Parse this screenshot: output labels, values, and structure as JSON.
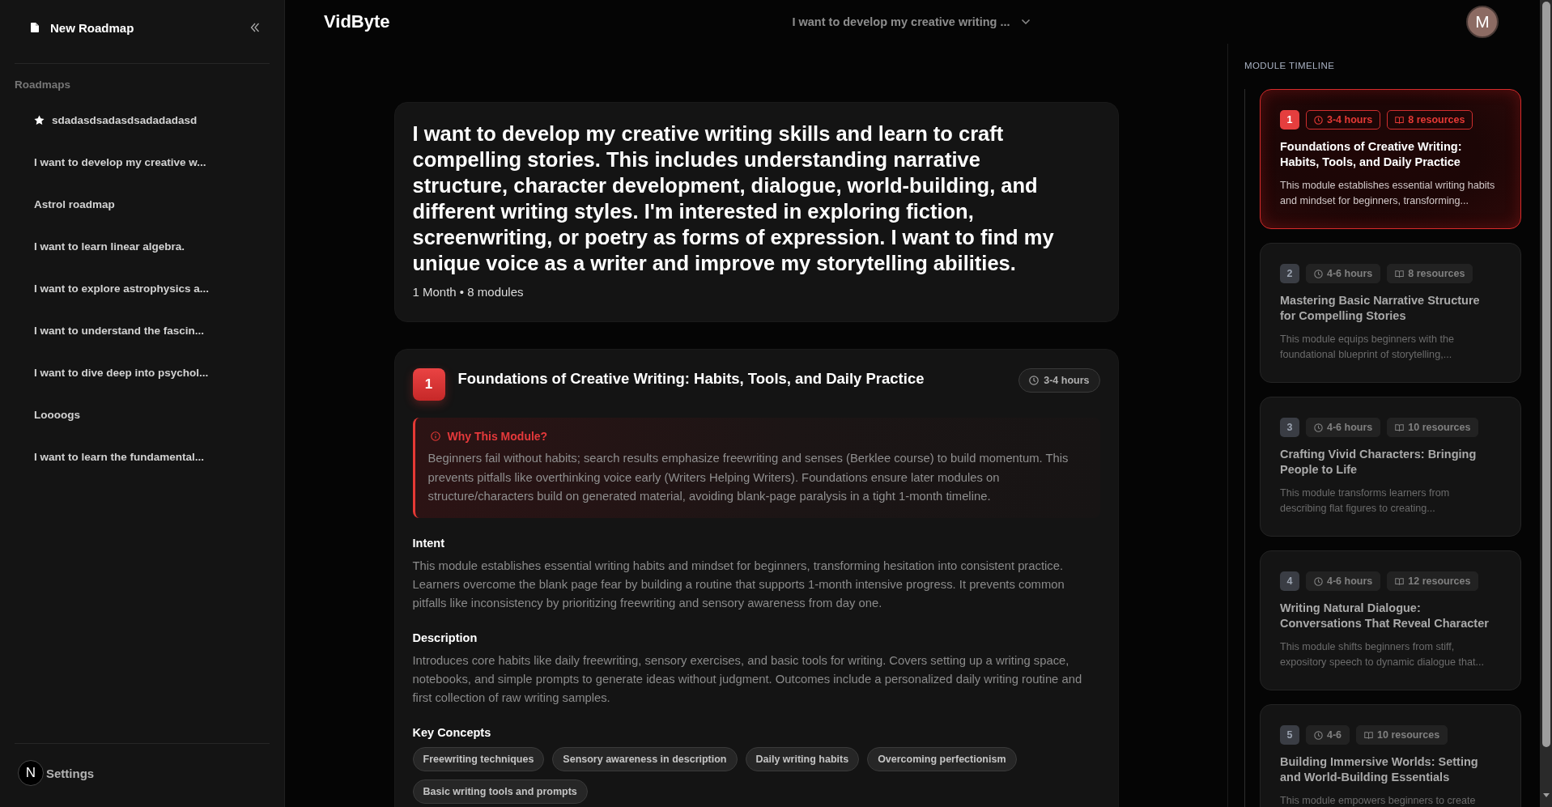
{
  "sidebar": {
    "new_button": "New Roadmap",
    "section_title": "Roadmaps",
    "items": [
      {
        "label": "sdadasdsadasdsadadadasd",
        "starred": true
      },
      {
        "label": "I want to develop my creative w...",
        "starred": false
      },
      {
        "label": "Astrol roadmap",
        "starred": false
      },
      {
        "label": "I want to learn linear algebra.",
        "starred": false
      },
      {
        "label": "I want to explore astrophysics a...",
        "starred": false
      },
      {
        "label": "I want to understand the fascin...",
        "starred": false
      },
      {
        "label": "I want to dive deep into psychol...",
        "starred": false
      },
      {
        "label": "Loooogs",
        "starred": false
      },
      {
        "label": "I want to learn the fundamental...",
        "starred": false
      }
    ],
    "footer": {
      "avatar_letter": "N",
      "label": "Settings"
    }
  },
  "header": {
    "logo": "VidByte",
    "roadmap_select": "I want to develop my creative writing ...",
    "avatar_letter": "M"
  },
  "roadmap": {
    "title": "I want to develop my creative writing skills and learn to craft compelling stories. This includes understanding narrative structure, character development, dialogue, world-building, and different writing styles. I'm interested in exploring fiction, screenwriting, or poetry as forms of expression. I want to find my unique voice as a writer and improve my storytelling abilities.",
    "meta": "1 Month • 8 modules"
  },
  "module": {
    "number": "1",
    "title": "Foundations of Creative Writing: Habits, Tools, and Daily Practice",
    "duration": "3-4 hours",
    "why": {
      "title": "Why This Module?",
      "text": "Beginners fail without habits; search results emphasize freewriting and senses (Berklee course) to build momentum. This prevents pitfalls like overthinking voice early (Writers Helping Writers). Foundations ensure later modules on structure/characters build on generated material, avoiding blank-page paralysis in a tight 1-month timeline."
    },
    "sections": [
      {
        "heading": "Intent",
        "text": "This module establishes essential writing habits and mindset for beginners, transforming hesitation into consistent practice. Learners overcome the blank page fear by building a routine that supports 1-month intensive progress. It prevents common pitfalls like inconsistency by prioritizing freewriting and sensory awareness from day one."
      },
      {
        "heading": "Description",
        "text": "Introduces core habits like daily freewriting, sensory exercises, and basic tools for writing. Covers setting up a writing space, notebooks, and simple prompts to generate ideas without judgment. Outcomes include a personalized daily writing routine and first collection of raw writing samples."
      }
    ],
    "key_concepts": {
      "heading": "Key Concepts",
      "tags": [
        "Freewriting techniques",
        "Sensory awareness in description",
        "Daily writing habits",
        "Overcoming perfectionism",
        "Basic writing tools and prompts"
      ]
    }
  },
  "timeline": {
    "title": "MODULE TIMELINE",
    "modules": [
      {
        "number": "1",
        "duration": "3-4 hours",
        "resources": "8 resources",
        "title": "Foundations of Creative Writing: Habits, Tools, and Daily Practice",
        "summary": "This module establishes essential writing habits and mindset for beginners, transforming...",
        "selected": true
      },
      {
        "number": "2",
        "duration": "4-6 hours",
        "resources": "8 resources",
        "title": "Mastering Basic Narrative Structure for Compelling Stories",
        "summary": "This module equips beginners with the foundational blueprint of storytelling,...",
        "selected": false
      },
      {
        "number": "3",
        "duration": "4-6 hours",
        "resources": "10 resources",
        "title": "Crafting Vivid Characters: Bringing People to Life",
        "summary": "This module transforms learners from describing flat figures to creating...",
        "selected": false
      },
      {
        "number": "4",
        "duration": "4-6 hours",
        "resources": "12 resources",
        "title": "Writing Natural Dialogue: Conversations That Reveal Character",
        "summary": "This module shifts beginners from stiff, expository speech to dynamic dialogue that...",
        "selected": false
      },
      {
        "number": "5",
        "duration": "4-6",
        "resources": "10 resources",
        "title": "Building Immersive Worlds: Setting and World-Building Essentials",
        "summary": "This module empowers beginners to create",
        "selected": false
      }
    ]
  }
}
